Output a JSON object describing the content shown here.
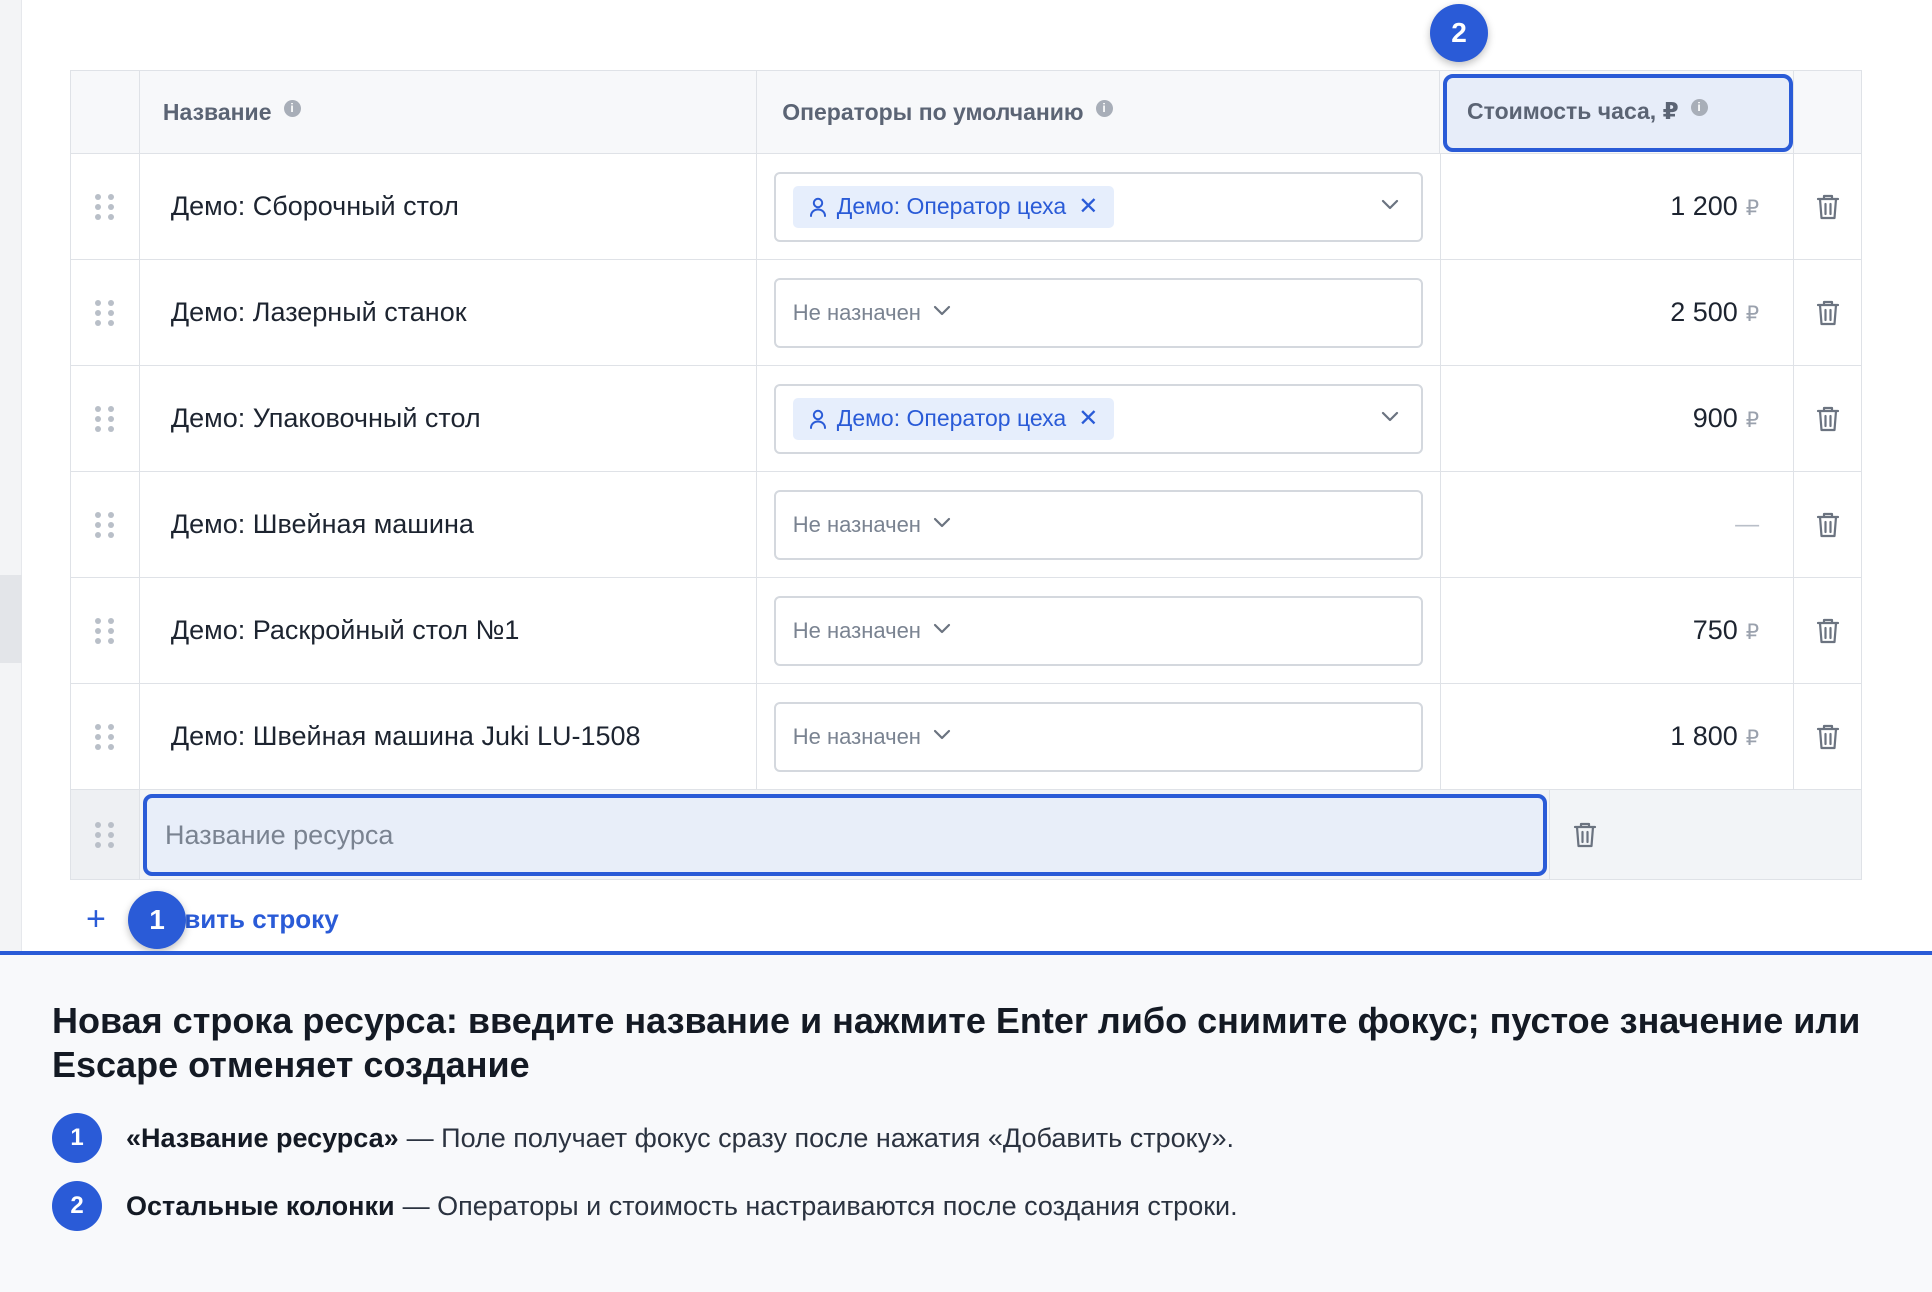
{
  "table": {
    "headers": {
      "name": "Название",
      "operators": "Операторы по умолчанию",
      "cost": "Стоимость часа, ₽",
      "info": "i"
    },
    "rows": [
      {
        "name": "Демо: Сборочный стол",
        "operator": "Демо: Оператор цеха",
        "assigned": true,
        "cost": "1 200",
        "currency": "₽"
      },
      {
        "name": "Демо: Лазерный станок",
        "operator": "Не назначен",
        "assigned": false,
        "cost": "2 500",
        "currency": "₽"
      },
      {
        "name": "Демо: Упаковочный стол",
        "operator": "Демо: Оператор цеха",
        "assigned": true,
        "cost": "900",
        "currency": "₽"
      },
      {
        "name": "Демо: Швейная машина",
        "operator": "Не назначен",
        "assigned": false,
        "cost": "—",
        "currency": ""
      },
      {
        "name": "Демо: Раскройный стол №1",
        "operator": "Не назначен",
        "assigned": false,
        "cost": "750",
        "currency": "₽"
      },
      {
        "name": "Демо: Швейная машина Juki LU-1508",
        "operator": "Не назначен",
        "assigned": false,
        "cost": "1 800",
        "currency": "₽"
      }
    ],
    "new_row": {
      "placeholder": "Название ресурса",
      "value": ""
    }
  },
  "add_row": {
    "label": "Добавить строку",
    "visible_label": "авить строку",
    "plus": "+"
  },
  "badges": {
    "one": "1",
    "two": "2"
  },
  "panel": {
    "title": "Новая строка ресурса: введите название и нажмите Enter либо снимите фокус; пустое значение или Escape отменяет создание",
    "notes": [
      {
        "num": "1",
        "term": "«Название ресурса»",
        "text": "— Поле получает фокус сразу после нажатия «Добавить строку»."
      },
      {
        "num": "2",
        "term": "Остальные колонки",
        "text": "— Операторы и стоимость настраиваются после создания строки."
      }
    ]
  },
  "icons": {
    "drag": "drag-handle-icon",
    "delete": "trash-icon",
    "user": "user-icon",
    "remove": "close-icon",
    "caret": "chevron-down-icon"
  },
  "colors": {
    "accent": "#2a5bd7",
    "chip_bg": "#e6eefc",
    "panel_bg": "#f8f9fb"
  }
}
